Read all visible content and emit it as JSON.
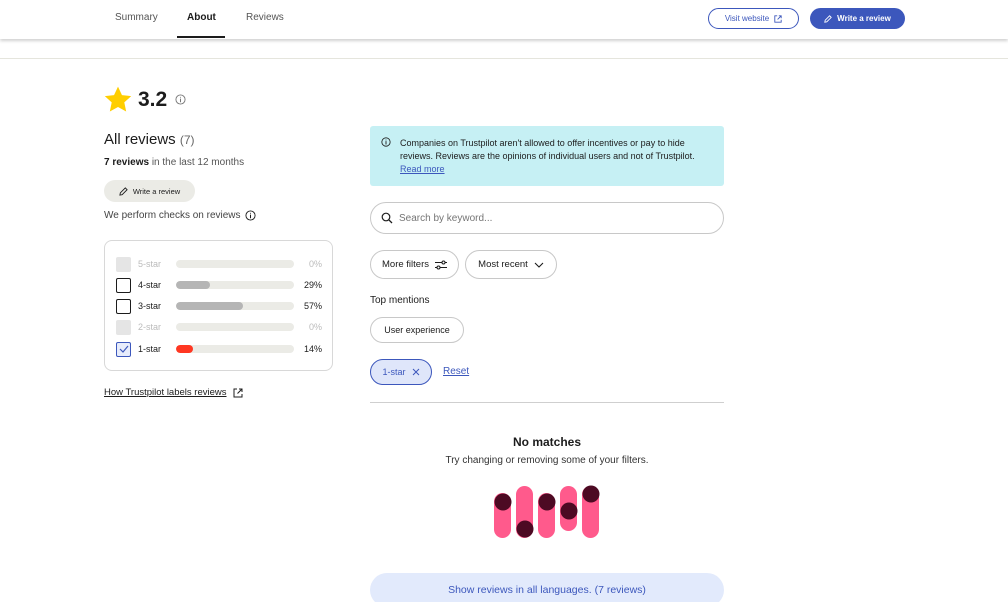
{
  "nav": {
    "tabs": [
      {
        "label": "Summary",
        "active": false
      },
      {
        "label": "About",
        "active": true
      },
      {
        "label": "Reviews",
        "active": false
      }
    ],
    "visit_website": "Visit website",
    "write_review": "Write a review"
  },
  "summary": {
    "rating": "3.2",
    "all_reviews_label": "All reviews",
    "all_reviews_count": "(7)",
    "period_count": "7 reviews",
    "period_text": " in the last 12 months",
    "write_review": "Write a review",
    "checks_text": "We perform checks on reviews",
    "labels_link": "How Trustpilot labels reviews"
  },
  "star_filters": [
    {
      "label": "5-star",
      "percent": 0,
      "percent_text": "0%",
      "state": "disabled"
    },
    {
      "label": "4-star",
      "percent": 29,
      "percent_text": "29%",
      "state": "unchecked"
    },
    {
      "label": "3-star",
      "percent": 57,
      "percent_text": "57%",
      "state": "unchecked"
    },
    {
      "label": "2-star",
      "percent": 0,
      "percent_text": "0%",
      "state": "disabled"
    },
    {
      "label": "1-star",
      "percent": 14,
      "percent_text": "14%",
      "state": "checked"
    }
  ],
  "notice": {
    "text": "Companies on Trustpilot aren't allowed to offer incentives or pay to hide reviews. Reviews are the opinions of individual users and not of Trustpilot.",
    "link": "Read more"
  },
  "search": {
    "placeholder": "Search by keyword..."
  },
  "filters": {
    "more_filters": "More filters",
    "sort": "Most recent"
  },
  "mentions": {
    "title": "Top mentions",
    "items": [
      "User experience"
    ]
  },
  "active_filter": {
    "label": "1-star",
    "reset": "Reset"
  },
  "empty_state": {
    "title": "No matches",
    "subtitle": "Try changing or removing some of your filters."
  },
  "show_all": "Show reviews in all languages. (7 reviews)",
  "colors": {
    "accent": "#3c57bc",
    "star": "#ffce00",
    "bar_gray": "#b5b5b5",
    "bar_red": "#ff3722",
    "notice_bg": "#c6f0f4",
    "illus_pink": "#ff5a8c",
    "illus_dark": "#4d0a23"
  }
}
